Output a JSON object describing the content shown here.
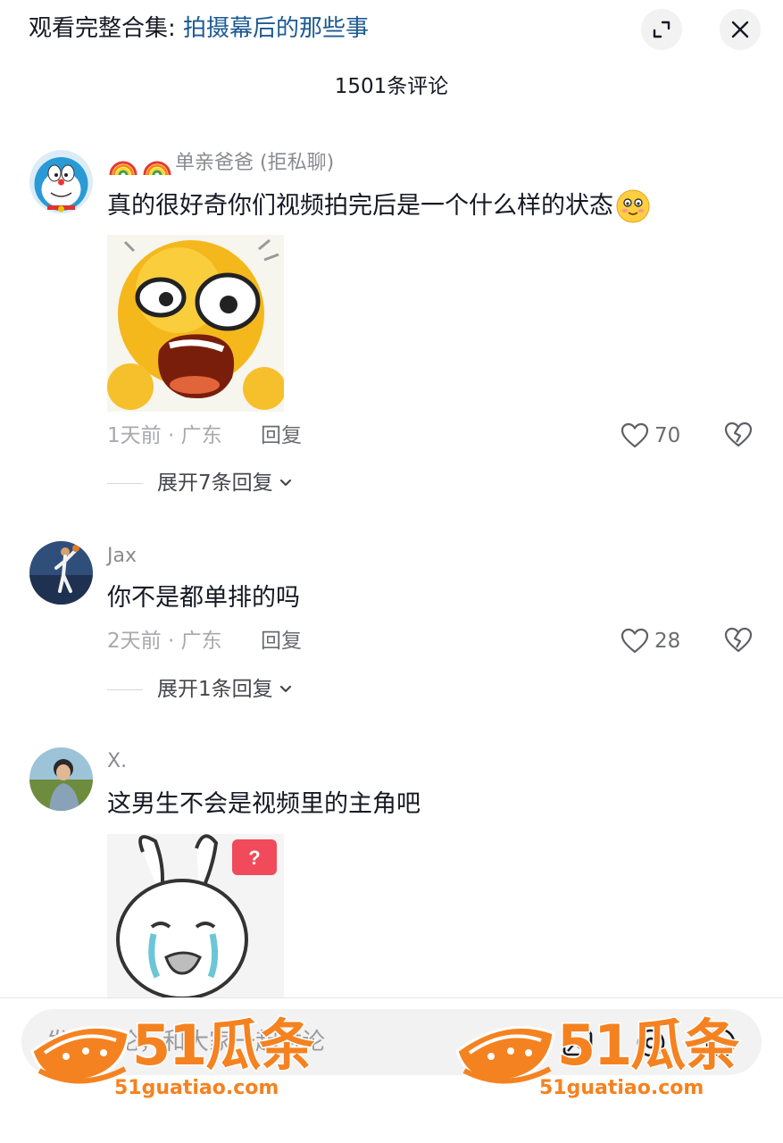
{
  "header": {
    "collection_prefix": "观看完整合集: ",
    "collection_title": "拍摄幕后的那些事"
  },
  "comment_count_label": "1501条评论",
  "comments": [
    {
      "username": "单亲爸爸 (拒私聊)",
      "username_emoji": "rainbow-emoji",
      "text": "真的很好奇你们视频拍完后是一个什么样的状态",
      "text_emoji": "blushing-face-emoji",
      "sticker": "shocked-yellow-face-sticker",
      "time_location": "1天前 · 广东",
      "reply_label": "回复",
      "likes": "70",
      "expand_label": "展开7条回复"
    },
    {
      "username": "Jax",
      "text": "你不是都单排的吗",
      "time_location": "2天前 · 广东",
      "reply_label": "回复",
      "likes": "28",
      "expand_label": "展开1条回复"
    },
    {
      "username": "X.",
      "text": "这男生不会是视频里的主角吧",
      "sticker": "crying-bunny-meme-sticker",
      "sticker_badge": "?"
    }
  ],
  "input": {
    "placeholder": "发条评论，和大家一起讨论"
  },
  "watermark": {
    "brand": "51瓜条",
    "site": "51guatiao.com"
  },
  "colors": {
    "link": "#1d5a93",
    "text": "#161823",
    "muted": "#a8a9ae",
    "watermark": "#f58220",
    "badge": "#f04a5b"
  }
}
